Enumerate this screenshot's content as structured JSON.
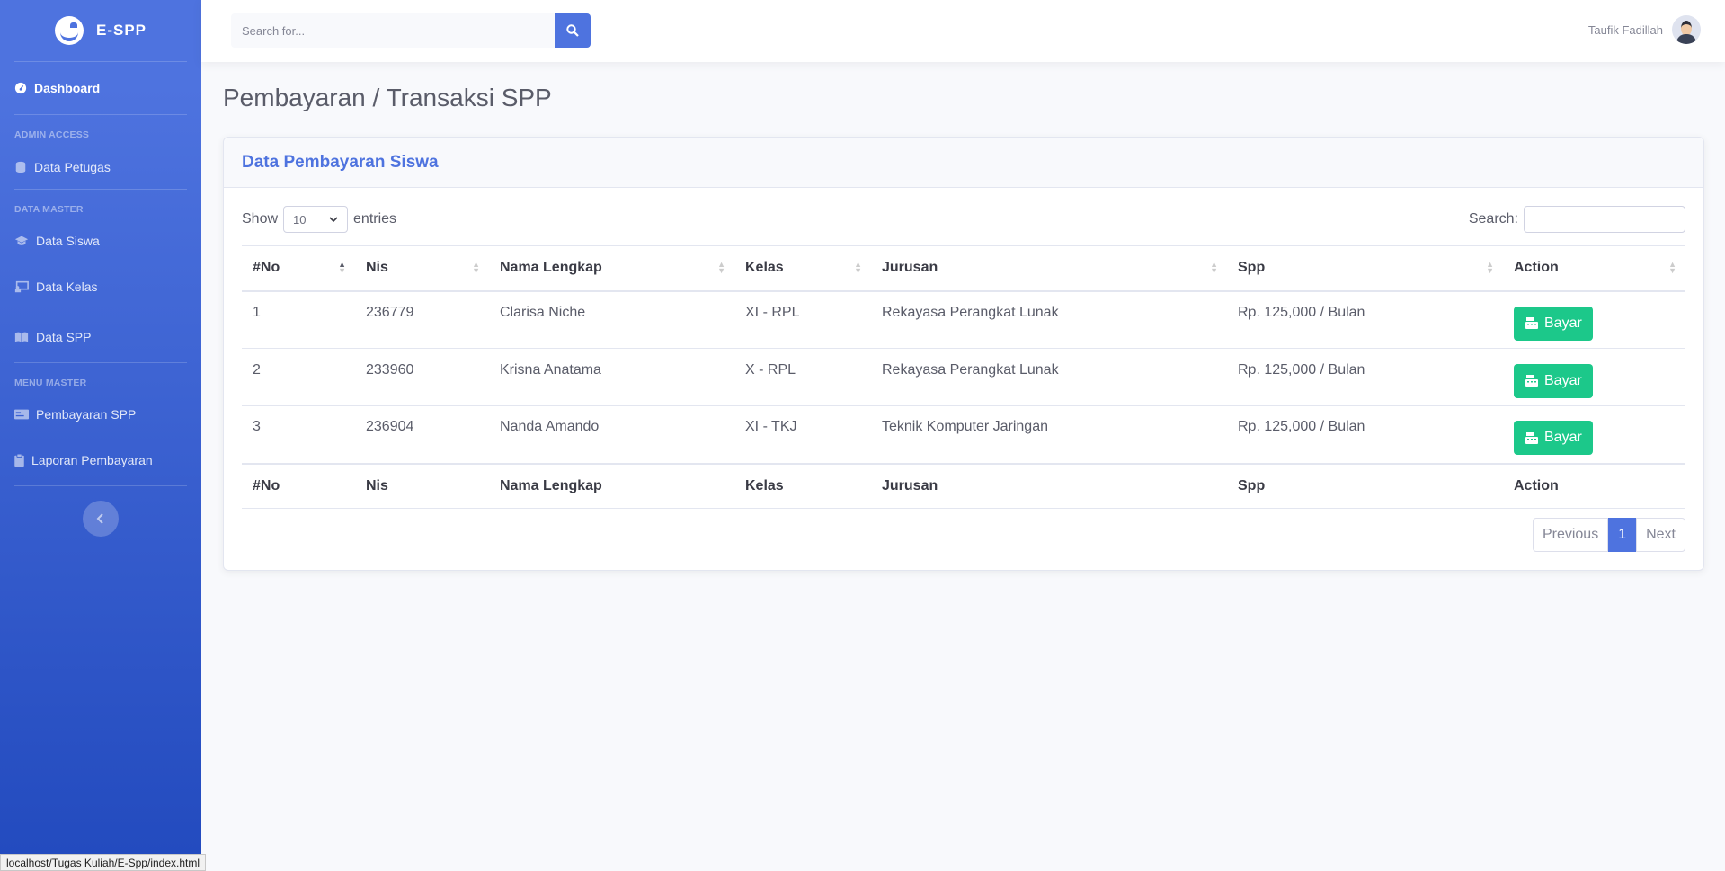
{
  "sidebar": {
    "brand": "E-SPP",
    "dashboard": "Dashboard",
    "headings": [
      "ADMIN ACCESS",
      "DATA MASTER",
      "MENU MASTER"
    ],
    "items": {
      "data_petugas": "Data Petugas",
      "data_siswa": "Data Siswa",
      "data_kelas": "Data Kelas",
      "data_spp": "Data SPP",
      "pembayaran_spp": "Pembayaran SPP",
      "laporan_pembayaran": "Laporan Pembayaran"
    }
  },
  "topbar": {
    "search_placeholder": "Search for...",
    "user_name": "Taufik Fadillah"
  },
  "page": {
    "title": "Pembayaran / Transaksi SPP"
  },
  "card": {
    "title": "Data Pembayaran Siswa",
    "show_label": "Show",
    "entries_value": "10",
    "entries_label": "entries",
    "search_label": "Search:"
  },
  "table": {
    "columns": [
      "#No",
      "Nis",
      "Nama Lengkap",
      "Kelas",
      "Jurusan",
      "Spp",
      "Action"
    ],
    "rows": [
      {
        "no": "1",
        "nis": "236779",
        "nama": "Clarisa Niche",
        "kelas": "XI - RPL",
        "jurusan": "Rekayasa Perangkat Lunak",
        "spp": "Rp. 125,000 / Bulan",
        "action": "Bayar"
      },
      {
        "no": "2",
        "nis": "233960",
        "nama": "Krisna Anatama",
        "kelas": "X - RPL",
        "jurusan": "Rekayasa Perangkat Lunak",
        "spp": "Rp. 125,000 / Bulan",
        "action": "Bayar"
      },
      {
        "no": "3",
        "nis": "236904",
        "nama": "Nanda Amando",
        "kelas": "XI - TKJ",
        "jurusan": "Teknik Komputer Jaringan",
        "spp": "Rp. 125,000 / Bulan",
        "action": "Bayar"
      }
    ]
  },
  "pagination": {
    "previous": "Previous",
    "current": "1",
    "next": "Next"
  },
  "statusbar": {
    "url": "localhost/Tugas Kuliah/E-Spp/index.html"
  },
  "colors": {
    "primary": "#4e73df",
    "success": "#1cc88a"
  }
}
